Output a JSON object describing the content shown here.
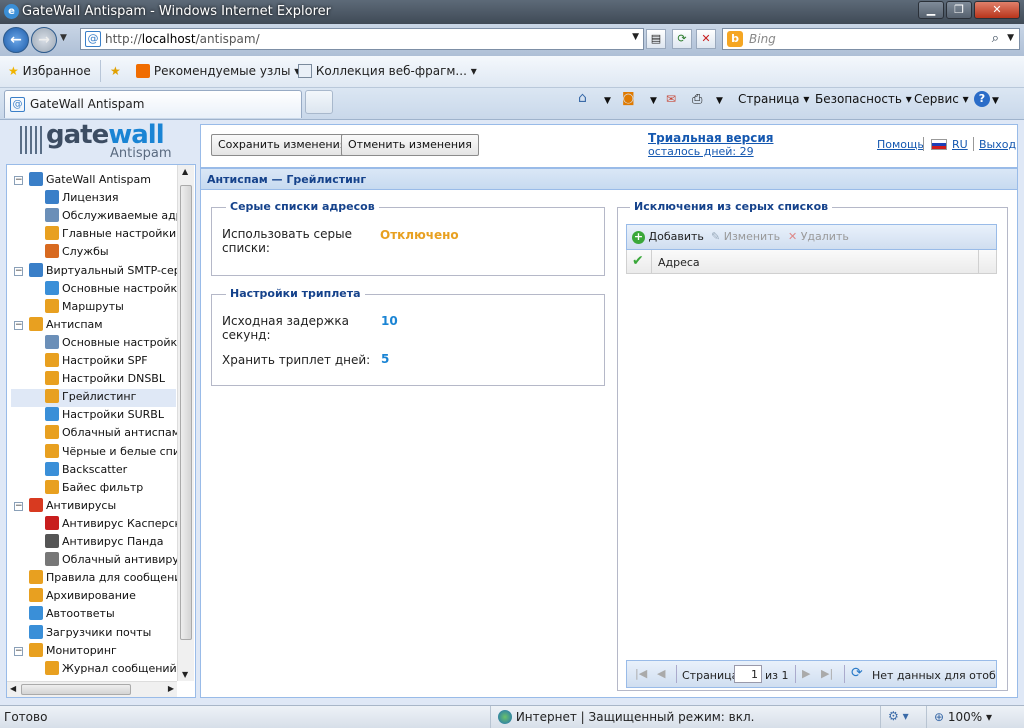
{
  "browser": {
    "window_title": "GateWall Antispam - Windows Internet Explorer",
    "url_prefix": "http://",
    "url_host": "localhost",
    "url_path": "/antispam/",
    "search_placeholder": "Bing",
    "favorites_label": "Избранное",
    "recommended_label": "Рекомендуемые узлы ▾",
    "webslice_label": "Коллекция веб-фрагм... ▾",
    "tab_title": "GateWall Antispam",
    "cmd_page": "Страница ▾",
    "cmd_safety": "Безопасность ▾",
    "cmd_tools": "Сервис ▾",
    "status_left": "Готово",
    "status_zone": "Интернет | Защищенный режим: вкл.",
    "zoom": "100%"
  },
  "logo": {
    "brand_a": "gate",
    "brand_b": "wall",
    "sub": "Antispam"
  },
  "toolbar": {
    "save": "Сохранить изменения",
    "cancel": "Отменить изменения",
    "trial": "Триальная версия",
    "days_left": "осталось дней: 29",
    "help": "Помощь",
    "lang": "RU",
    "logout": "Выход"
  },
  "tree": [
    {
      "label": "GateWall Antispam",
      "level": 0,
      "exp": "−",
      "color": "#3a7fc8"
    },
    {
      "label": "Лицензия",
      "level": 1,
      "color": "#3a7fc8"
    },
    {
      "label": "Обслуживаемые адреса",
      "level": 1,
      "color": "#6b8fb8"
    },
    {
      "label": "Главные настройки",
      "level": 1,
      "color": "#e8a020"
    },
    {
      "label": "Службы",
      "level": 1,
      "color": "#d86a20"
    },
    {
      "label": "Виртуальный SMTP-сервер",
      "level": 0,
      "exp": "−",
      "color": "#3a7fc8"
    },
    {
      "label": "Основные настройки",
      "level": 1,
      "color": "#3a8fd8"
    },
    {
      "label": "Маршруты",
      "level": 1,
      "color": "#e8a020"
    },
    {
      "label": "Антиспам",
      "level": 0,
      "exp": "−",
      "color": "#e8a020"
    },
    {
      "label": "Основные настройки",
      "level": 1,
      "color": "#6b8fb8"
    },
    {
      "label": "Настройки SPF",
      "level": 1,
      "color": "#e8a020"
    },
    {
      "label": "Настройки DNSBL",
      "level": 1,
      "color": "#e8a020"
    },
    {
      "label": "Грейлистинг",
      "level": 1,
      "color": "#e8a020",
      "selected": true
    },
    {
      "label": "Настройки SURBL",
      "level": 1,
      "color": "#3a8fd8"
    },
    {
      "label": "Облачный антиспам",
      "level": 1,
      "color": "#e8a020"
    },
    {
      "label": "Чёрные и белые списки",
      "level": 1,
      "color": "#e8a020"
    },
    {
      "label": "Backscatter",
      "level": 1,
      "color": "#3a8fd8"
    },
    {
      "label": "Байес фильтр",
      "level": 1,
      "color": "#e8a020"
    },
    {
      "label": "Антивирусы",
      "level": 0,
      "exp": "−",
      "color": "#d83a20"
    },
    {
      "label": "Антивирус Касперского",
      "level": 1,
      "color": "#c81e1e"
    },
    {
      "label": "Антивирус Панда",
      "level": 1,
      "color": "#555"
    },
    {
      "label": "Облачный антивирус",
      "level": 1,
      "color": "#777"
    },
    {
      "label": "Правила для сообщений",
      "level": 0,
      "color": "#e8a020"
    },
    {
      "label": "Архивирование",
      "level": 0,
      "color": "#e8a020"
    },
    {
      "label": "Автоответы",
      "level": 0,
      "color": "#3a8fd8"
    },
    {
      "label": "Загрузчики почты",
      "level": 0,
      "color": "#3a8fd8"
    },
    {
      "label": "Мониторинг",
      "level": 0,
      "exp": "−",
      "color": "#e8a020"
    },
    {
      "label": "Журнал сообщений",
      "level": 1,
      "color": "#e8a020"
    }
  ],
  "main": {
    "header": "Антиспам — Грейлистинг",
    "gray_lists": {
      "legend": "Серые списки адресов",
      "use_label": "Использовать серые списки:",
      "use_value": "Отключено"
    },
    "triplet": {
      "legend": "Настройки триплета",
      "delay_label": "Исходная задержка секунд:",
      "delay_value": "10",
      "keep_label": "Хранить триплет дней:",
      "keep_value": "5"
    },
    "exceptions": {
      "legend": "Исключения из серых списков",
      "add": "Добавить",
      "edit": "Изменить",
      "delete": "Удалить",
      "col_addresses": "Адреса",
      "page_label": "Страница",
      "page_value": "1",
      "of_label": "из 1",
      "no_data": "Нет данных для отображения"
    }
  },
  "colors": {
    "accent": "#15428b",
    "disabled_value": "#e8a020",
    "number_value": "#1a84d4"
  }
}
